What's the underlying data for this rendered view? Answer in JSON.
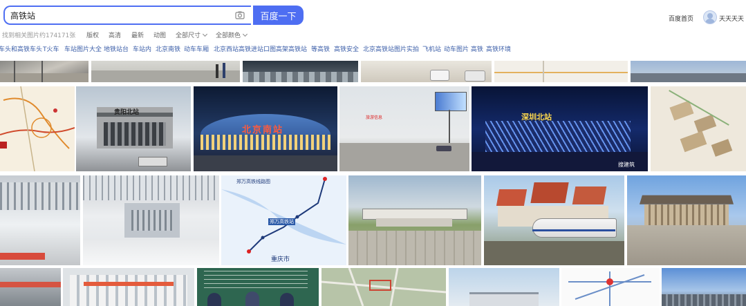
{
  "search": {
    "query": "高铁站",
    "button_label": "百度一下"
  },
  "header": {
    "home_link": "百度首页",
    "username": "天天天天"
  },
  "result_count": "找到相关图片约174171张",
  "filters": [
    "版权",
    "高清",
    "最新",
    "动图",
    "全部尺寸",
    "全部颜色"
  ],
  "related_tags": [
    "车头和高铁车头",
    "T火车",
    "车站图片大全",
    "地铁站台",
    "车站内",
    "北京南铁",
    "动车车厢",
    "北京西站高铁进站口图",
    "高架高铁站",
    "等高铁",
    "高铁安全",
    "北京高铁站图片实拍",
    "飞机站",
    "动车图片 高铁",
    "高铁环境"
  ],
  "image_captions": {
    "beijing_south": "北京南站",
    "shenzhen_north": "深圳北站",
    "map_title": "郑万高铁线路图",
    "map_city": "重庆市",
    "station_sign": "贵阳北站",
    "map_station": "郑万高铁站",
    "watermark": "搜建筑",
    "photo_tag": "旅游信息"
  },
  "colors": {
    "accent": "#4e6ef2",
    "tag_link": "#3b5ea8"
  }
}
